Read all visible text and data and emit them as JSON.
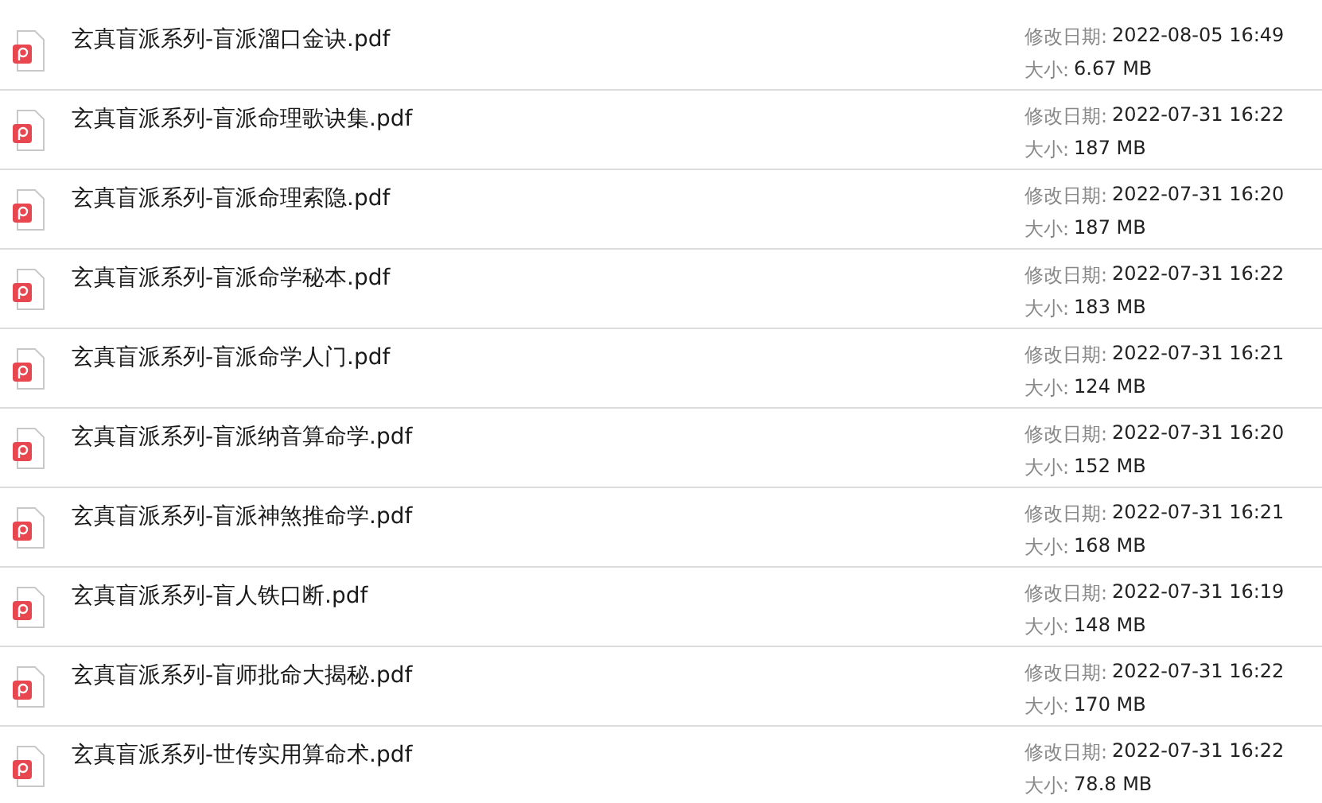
{
  "files": [
    {
      "name": "玄真盲派系列-盲派溜口金诀.pdf",
      "modified_label": "修改日期:",
      "modified": "2022-08-05 16:49",
      "size_label": "大小:",
      "size": "6.67 MB"
    },
    {
      "name": "玄真盲派系列-盲派命理歌诀集.pdf",
      "modified_label": "修改日期:",
      "modified": "2022-07-31 16:22",
      "size_label": "大小:",
      "size": "187 MB"
    },
    {
      "name": "玄真盲派系列-盲派命理索隐.pdf",
      "modified_label": "修改日期:",
      "modified": "2022-07-31 16:20",
      "size_label": "大小:",
      "size": "187 MB"
    },
    {
      "name": "玄真盲派系列-盲派命学秘本.pdf",
      "modified_label": "修改日期:",
      "modified": "2022-07-31 16:22",
      "size_label": "大小:",
      "size": "183 MB"
    },
    {
      "name": "玄真盲派系列-盲派命学人门.pdf",
      "modified_label": "修改日期:",
      "modified": "2022-07-31 16:21",
      "size_label": "大小:",
      "size": "124 MB"
    },
    {
      "name": "玄真盲派系列-盲派纳音算命学.pdf",
      "modified_label": "修改日期:",
      "modified": "2022-07-31 16:20",
      "size_label": "大小:",
      "size": "152 MB"
    },
    {
      "name": "玄真盲派系列-盲派神煞推命学.pdf",
      "modified_label": "修改日期:",
      "modified": "2022-07-31 16:21",
      "size_label": "大小:",
      "size": "168 MB"
    },
    {
      "name": "玄真盲派系列-盲人铁口断.pdf",
      "modified_label": "修改日期:",
      "modified": "2022-07-31 16:19",
      "size_label": "大小:",
      "size": "148 MB"
    },
    {
      "name": "玄真盲派系列-盲师批命大揭秘.pdf",
      "modified_label": "修改日期:",
      "modified": "2022-07-31 16:22",
      "size_label": "大小:",
      "size": "170 MB"
    },
    {
      "name": "玄真盲派系列-世传实用算命术.pdf",
      "modified_label": "修改日期:",
      "modified": "2022-07-31 16:22",
      "size_label": "大小:",
      "size": "78.8 MB"
    }
  ]
}
